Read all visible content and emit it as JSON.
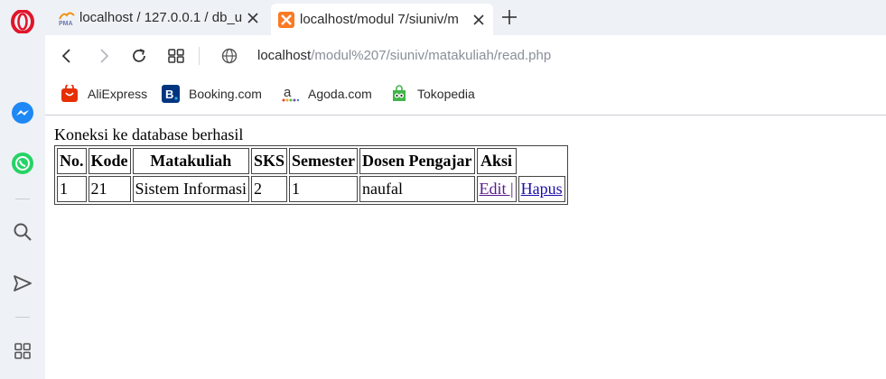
{
  "browser": {
    "tabs": [
      {
        "title": "localhost / 127.0.0.1 / db_u",
        "favicon": "phpmyadmin-icon",
        "active": false
      },
      {
        "title": "localhost/modul 7/siuniv/m",
        "favicon": "xampp-icon",
        "active": true
      }
    ],
    "url": {
      "host": "localhost",
      "path": "/modul%207/siuniv/matakuliah/read.php"
    },
    "bookmarks": [
      {
        "label": "AliExpress",
        "icon": "aliexpress-icon"
      },
      {
        "label": "Booking.com",
        "icon": "booking-icon"
      },
      {
        "label": "Agoda.com",
        "icon": "agoda-icon"
      },
      {
        "label": "Tokopedia",
        "icon": "tokopedia-icon"
      }
    ],
    "sidebar_icons": [
      "opera-logo-icon",
      "messenger-icon",
      "whatsapp-icon",
      "search-icon",
      "send-icon",
      "apps-grid-icon"
    ]
  },
  "page": {
    "status_text": "Koneksi ke database berhasil",
    "table": {
      "headers": [
        "No.",
        "Kode",
        "Matakuliah",
        "SKS",
        "Semester",
        "Dosen Pengajar",
        "Aksi"
      ],
      "rows": [
        {
          "no": "1",
          "kode": "21",
          "matakuliah": "Sistem Informasi",
          "sks": "2",
          "semester": "1",
          "dosen": "naufal",
          "edit": "Edit |",
          "hapus": "Hapus"
        }
      ]
    }
  },
  "colors": {
    "link": "#1a0dab",
    "visited_link": "#551a8b",
    "chrome_bg": "#eef1f5",
    "opera_red": "#e0162b"
  }
}
